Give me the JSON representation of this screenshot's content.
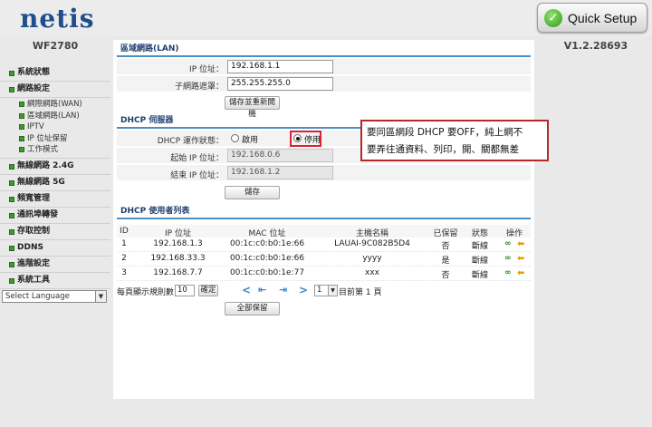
{
  "header": {
    "logo": "netis",
    "quick_setup": "Quick Setup",
    "model": "WF2780",
    "version": "V1.2.28693"
  },
  "sidebar": {
    "items": [
      {
        "label": "系統狀態"
      },
      {
        "label": "網路設定"
      },
      {
        "label": "無線網路 2.4G"
      },
      {
        "label": "無線網路 5G"
      },
      {
        "label": "頻寬管理"
      },
      {
        "label": "通訊埠轉發"
      },
      {
        "label": "存取控制"
      },
      {
        "label": "DDNS"
      },
      {
        "label": "進階設定"
      },
      {
        "label": "系統工具"
      }
    ],
    "subitems": [
      {
        "label": "網際網路(WAN)"
      },
      {
        "label": "區域網路(LAN)"
      },
      {
        "label": "IPTV"
      },
      {
        "label": "IP 位址保留"
      },
      {
        "label": "工作模式"
      }
    ],
    "language": "Select Language"
  },
  "lan": {
    "title": "區域網路(LAN)",
    "ip_label": "IP 位址：",
    "ip_value": "192.168.1.1",
    "mask_label": "子網路遮罩：",
    "mask_value": "255.255.255.0",
    "save_button": "儲存並重新開機"
  },
  "dhcp": {
    "title": "DHCP 伺服器",
    "status_label": "DHCP 運作狀態：",
    "enable_label": "啟用",
    "disable_label": "停用",
    "selected": "disable",
    "start_label": "起始 IP 位址：",
    "start_value": "192.168.0.6",
    "end_label": "結束 IP 位址：",
    "end_value": "192.168.1.2",
    "save_button": "儲存"
  },
  "clients": {
    "title": "DHCP 使用者列表",
    "headers": [
      "ID",
      "IP 位址",
      "MAC 位址",
      "主機名稱",
      "已保留",
      "狀態",
      "操作"
    ],
    "rows": [
      {
        "id": "1",
        "ip": "192.168.1.3",
        "mac": "00:1c:c0:b0:1e:66",
        "host": "LAUAI-9C082B5D4",
        "reserved": "否",
        "status": "斷線"
      },
      {
        "id": "2",
        "ip": "192.168.33.3",
        "mac": "00:1c:c0:b0:1e:66",
        "host": "yyyy",
        "reserved": "是",
        "status": "斷線"
      },
      {
        "id": "3",
        "ip": "192.168.7.7",
        "mac": "00:1c:c0:b0:1e:77",
        "host": "xxx",
        "reserved": "否",
        "status": "斷線"
      }
    ],
    "per_page_label": "每頁顯示規則數",
    "per_page_value": "10",
    "confirm_button": "確定",
    "page_select": "1",
    "page_text": "目前第 1 頁",
    "reserve_all_button": "全部保留"
  },
  "callout": {
    "line1": "要同區網段 DHCP 要OFF，純上網不",
    "line2": "要弄往通資料、列印，開、關都無差"
  },
  "colors": {
    "accent": "#4a8fc4",
    "brand": "#1f4e8c",
    "bullet": "#3f9a2e",
    "callout_border": "#b5272b"
  }
}
